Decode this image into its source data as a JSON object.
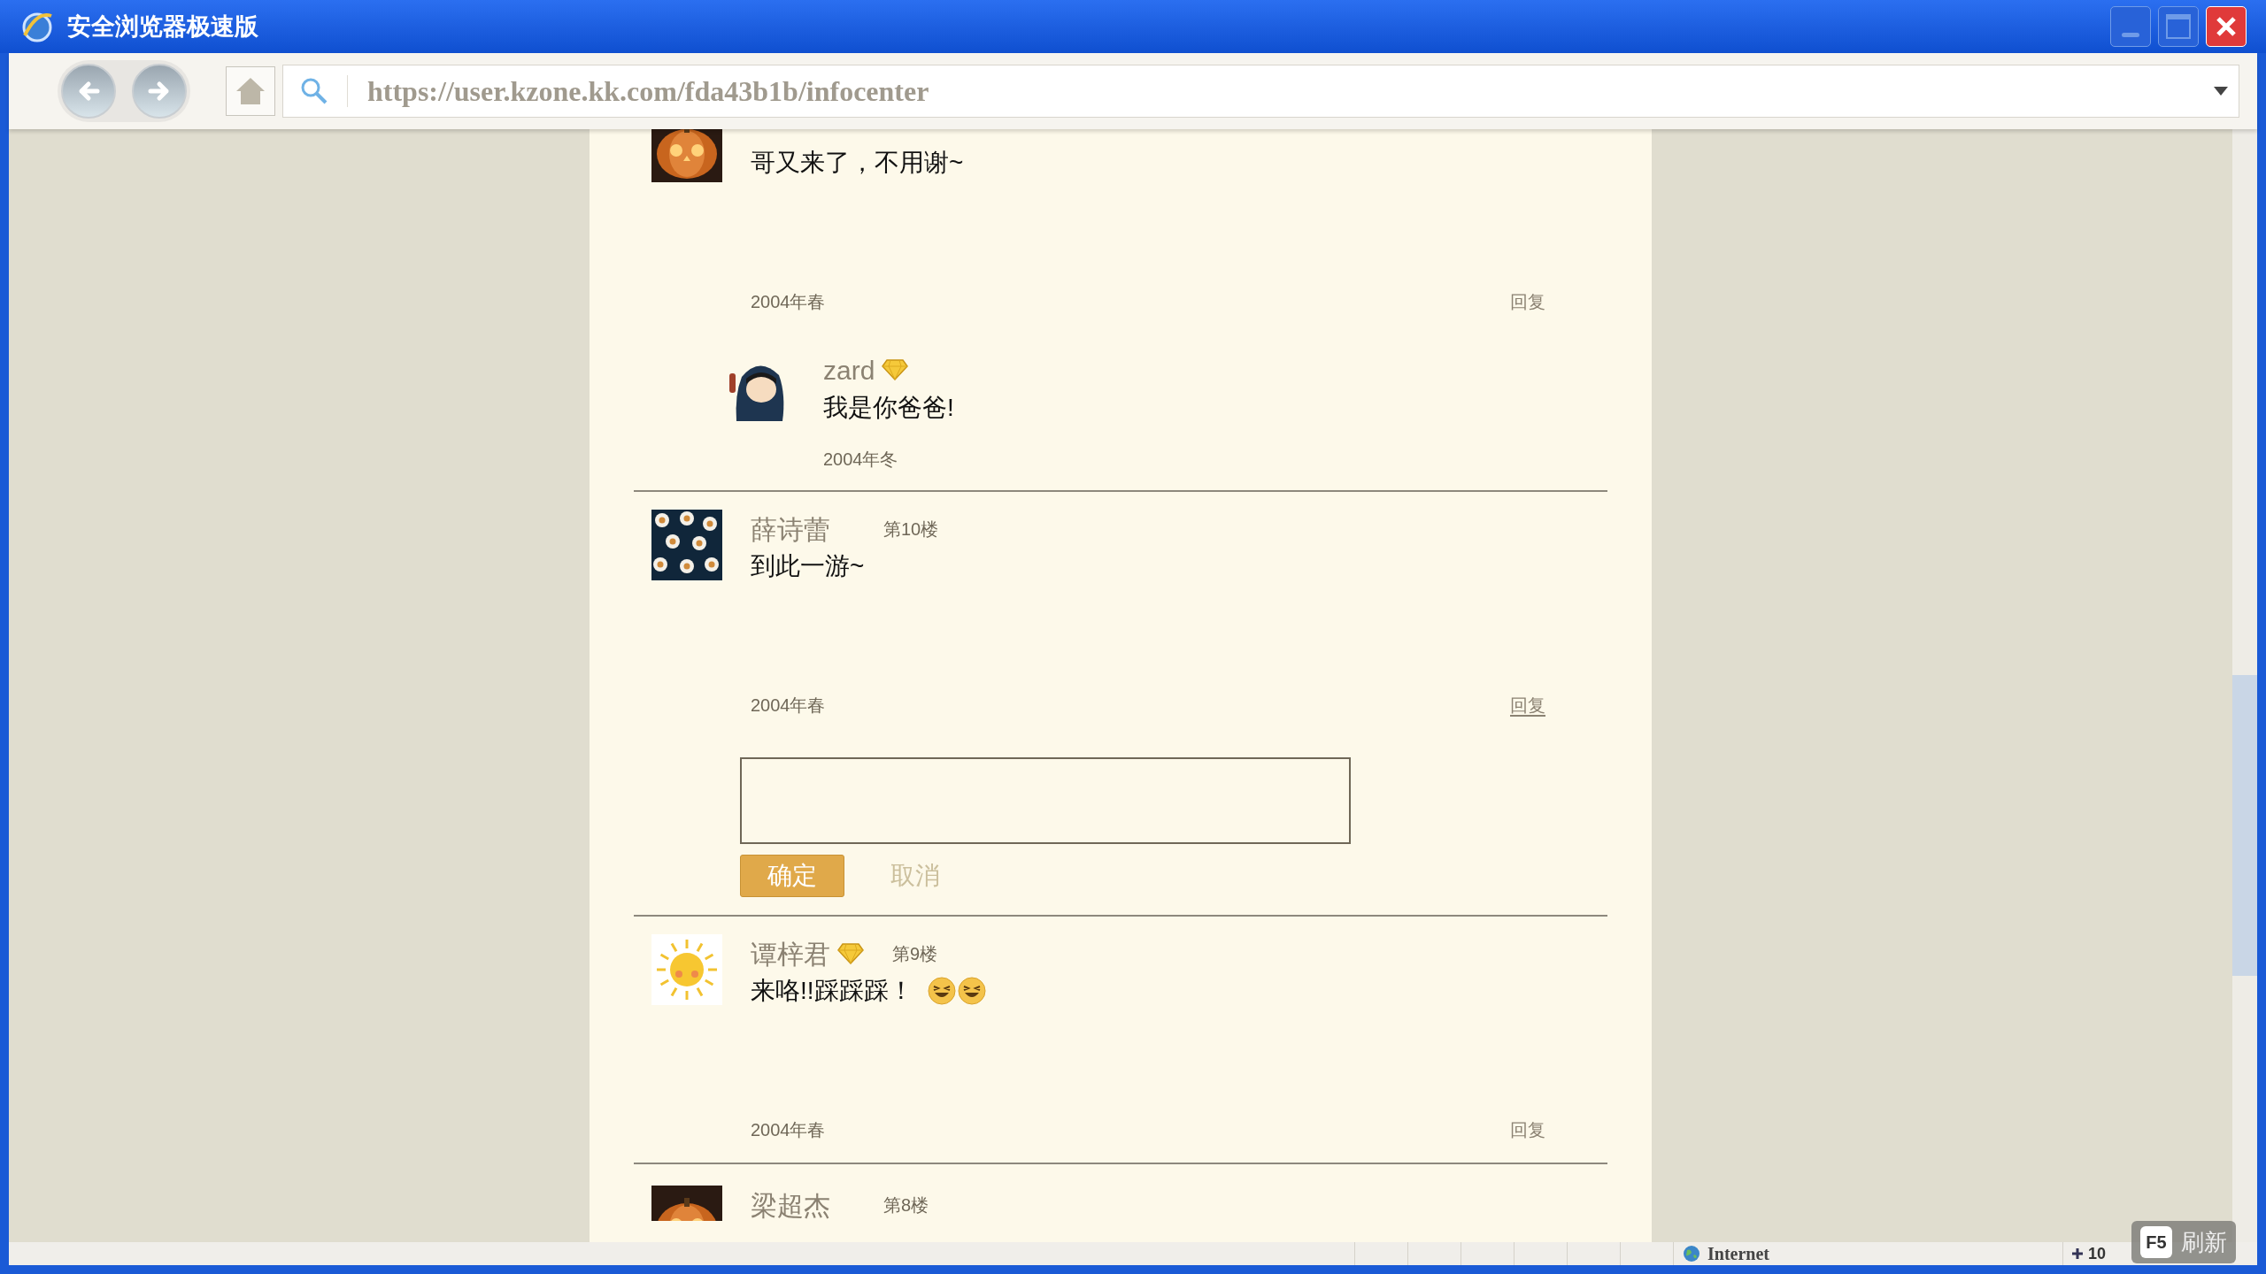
{
  "window": {
    "title": "安全浏览器极速版"
  },
  "toolbar": {
    "address": "https://user.kzone.kk.com/fda43b1b/infocenter"
  },
  "comments": [
    {
      "avatar": {
        "kind": "picture"
      },
      "text": "哥又来了，不用谢~",
      "date": "2004年春",
      "reply_link": "回复",
      "hovered": false,
      "replies": [
        {
          "avatar": {
            "kind": "picture"
          },
          "name": "zard",
          "vip": true,
          "text": "我是你爸爸!",
          "date": "2004年冬"
        }
      ]
    },
    {
      "avatar": {
        "kind": "picture"
      },
      "name": "薛诗蕾",
      "vip": false,
      "floor": "第10楼",
      "text": "到此一游~",
      "date": "2004年春",
      "reply_link": "回复",
      "hovered": true,
      "reply_box": {
        "confirm": "确定",
        "cancel": "取消"
      }
    },
    {
      "avatar": {
        "kind": "picture"
      },
      "name": "谭梓君",
      "vip": true,
      "floor": "第9楼",
      "text": "来咯!!踩踩踩！",
      "emojis": [
        {
          "kind": "grin"
        },
        {
          "kind": "grin"
        }
      ],
      "date": "2004年春",
      "reply_link": "回复",
      "hovered": false
    },
    {
      "avatar": {
        "kind": "picture"
      },
      "name": "梁超杰",
      "vip": false,
      "floor": "第8楼",
      "cut": true
    }
  ],
  "status_bar": {
    "zone": "Internet",
    "zoom": "10"
  },
  "hint": {
    "key": "F5",
    "label": "刷新"
  }
}
